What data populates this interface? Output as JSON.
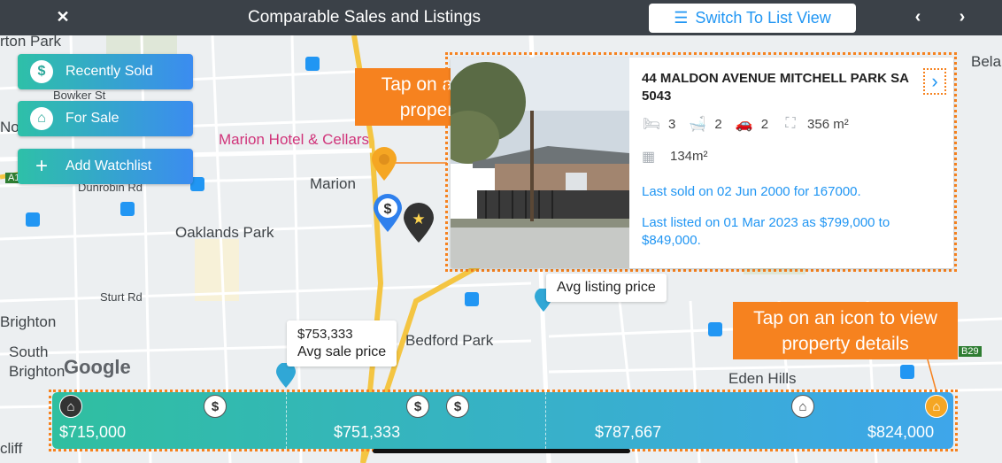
{
  "topbar": {
    "close_icon": "close-icon",
    "title": "Comparable Sales and Listings",
    "switch_label": "Switch To List View",
    "prev_icon": "chevron-left-icon",
    "next_icon": "chevron-right-icon"
  },
  "filters": [
    {
      "label": "Recently Sold",
      "icon": "dollar-icon",
      "glyph": "$"
    },
    {
      "label": "For Sale",
      "icon": "home-icon",
      "glyph": "⌂"
    },
    {
      "label": "Add Watchlist",
      "icon": "plus-icon",
      "glyph": "+"
    }
  ],
  "callouts": {
    "pin": "Tap on a pin to view property details",
    "icon": "Tap on an icon to view property details"
  },
  "map_labels": {
    "arton_park": "rton Park",
    "bowker": "Bowker St",
    "marion_hotel": "Marion Hotel & Cellars",
    "dunrobin": "Dunrobin Rd",
    "marion": "Marion",
    "oaklands": "Oaklands Park",
    "sturt": "Sturt Rd",
    "brighton": "Brighton",
    "south_brighton": "South\nBrighton",
    "bedford": "Bedford Park",
    "eden": "Eden Hills",
    "bela": "Bela",
    "nor": "No",
    "a1": "A1",
    "b29": "B29",
    "cliff": "cliff",
    "google": "Google"
  },
  "card": {
    "address": "44 MALDON AVENUE MITCHELL PARK SA 5043",
    "beds": "3",
    "baths": "2",
    "cars": "2",
    "land": "356 m²",
    "floor": "134m²",
    "sold": "Last sold on 02 Jun 2000 for 167000.",
    "listed": "Last listed on 01 Mar 2023 as $799,000 to $849,000."
  },
  "tips": {
    "sale_value": "$753,333",
    "sale_label": "Avg sale price",
    "listing_label": "Avg listing price"
  },
  "pricebar": {
    "labels": [
      "$715,000",
      "$751,333",
      "$787,667",
      "$824,000"
    ]
  },
  "colors": {
    "accent": "#2196f3",
    "orange": "#f6821f",
    "topbar": "#3b4148"
  }
}
